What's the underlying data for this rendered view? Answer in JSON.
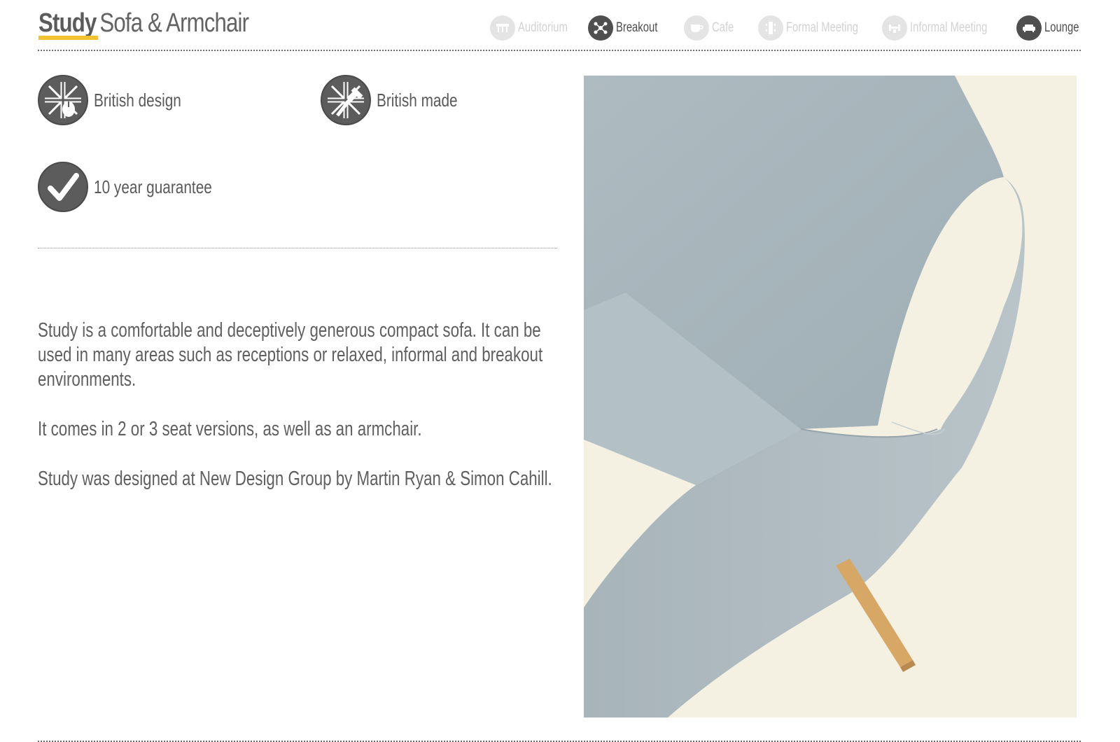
{
  "header": {
    "brand": "Study",
    "subtitle": "Sofa & Armchair"
  },
  "nav": {
    "items": [
      {
        "label": "Auditorium",
        "icon": "auditorium-icon",
        "active": false
      },
      {
        "label": "Breakout",
        "icon": "breakout-icon",
        "active": true
      },
      {
        "label": "Cafe",
        "icon": "cafe-cup-icon",
        "active": false
      },
      {
        "label": "Formal Meeting",
        "icon": "formal-meeting-icon",
        "active": false
      },
      {
        "label": "Informal Meeting",
        "icon": "informal-meeting-icon",
        "active": false
      },
      {
        "label": "Lounge",
        "icon": "lounge-sofa-icon",
        "active": true
      }
    ]
  },
  "features": [
    {
      "label": "British design",
      "icon": "british-design-icon"
    },
    {
      "label": "British made",
      "icon": "british-made-icon"
    },
    {
      "label": "10 year guarantee",
      "icon": "checkmark-icon"
    }
  ],
  "description": {
    "paragraphs": [
      "Study is a comfortable and deceptively generous compact sofa. It can be used in many areas such as receptions or relaxed, informal and breakout environments.",
      "It comes in 2 or 3 seat versions, as well as an armchair.",
      "Study was designed at New Design Group by Martin Ryan & Simon Cahill."
    ]
  },
  "colors": {
    "accent_underline": "#f2c230",
    "icon_dark": "#4f4f4f",
    "icon_inactive": "#e4e4e4",
    "sofa_fabric": "#a9b6bc",
    "sofa_leg": "#d7a766",
    "photo_background": "#f4f1e3"
  },
  "photo": {
    "subject": "grey-blue upholstered sofa with wooden legs"
  }
}
